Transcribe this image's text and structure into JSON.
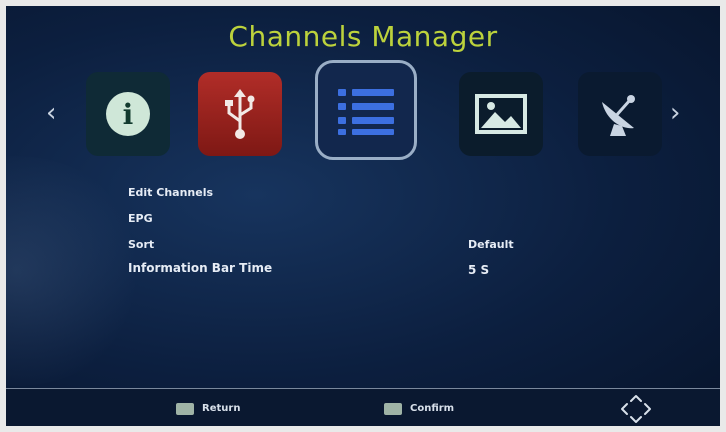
{
  "title": "Channels Manager",
  "nav": {
    "left_arrow": "‹",
    "right_arrow": "›"
  },
  "icons": [
    {
      "name": "info-icon",
      "selected": false
    },
    {
      "name": "usb-icon",
      "selected": false
    },
    {
      "name": "list-icon",
      "selected": true
    },
    {
      "name": "media-icon",
      "selected": false
    },
    {
      "name": "satellite-dish-icon",
      "selected": false
    }
  ],
  "info_icon_glyph": "i",
  "menu": {
    "items": [
      {
        "label": "Edit Channels",
        "value": ""
      },
      {
        "label": "EPG",
        "value": ""
      },
      {
        "label": "Sort",
        "value": "Default"
      },
      {
        "label": "Information Bar Time",
        "value": "5 S"
      }
    ]
  },
  "footer": {
    "return_label": "Return",
    "confirm_label": "Confirm"
  },
  "colors": {
    "title": "#bcd23c",
    "background": "#0c1f3f",
    "usb_tile": "#b12d28",
    "selected_border": "#9aaec6"
  }
}
